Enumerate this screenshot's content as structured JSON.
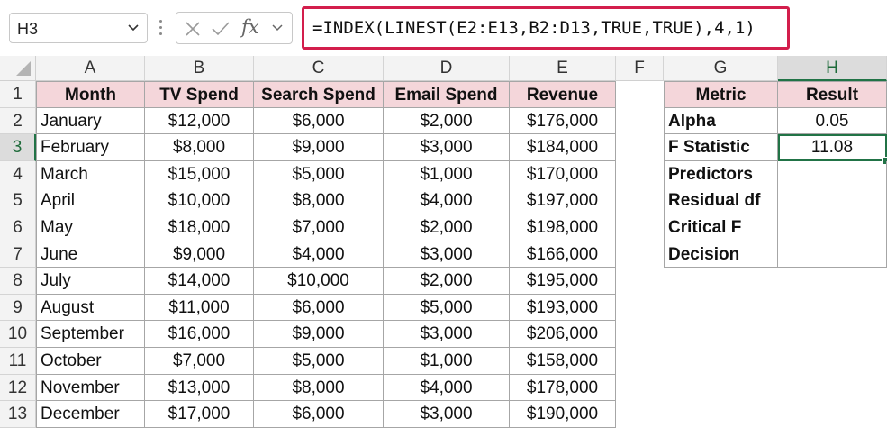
{
  "formula_bar": {
    "name_box": "H3",
    "formula": "=INDEX(LINEST(E2:E13,B2:D13,TRUE,TRUE),4,1)",
    "cancel_icon": "x-icon",
    "enter_icon": "check-icon",
    "fx_label": "fx"
  },
  "columns": [
    "A",
    "B",
    "C",
    "D",
    "E",
    "F",
    "G",
    "H"
  ],
  "rows": [
    "1",
    "2",
    "3",
    "4",
    "5",
    "6",
    "7",
    "8",
    "9",
    "10",
    "11",
    "12",
    "13"
  ],
  "table": {
    "headers": [
      "Month",
      "TV Spend",
      "Search Spend",
      "Email Spend",
      "Revenue"
    ],
    "rows": [
      [
        "January",
        "$12,000",
        "$6,000",
        "$2,000",
        "$176,000"
      ],
      [
        "February",
        "$8,000",
        "$9,000",
        "$3,000",
        "$184,000"
      ],
      [
        "March",
        "$15,000",
        "$5,000",
        "$1,000",
        "$170,000"
      ],
      [
        "April",
        "$10,000",
        "$8,000",
        "$4,000",
        "$197,000"
      ],
      [
        "May",
        "$18,000",
        "$7,000",
        "$2,000",
        "$198,000"
      ],
      [
        "June",
        "$9,000",
        "$4,000",
        "$3,000",
        "$166,000"
      ],
      [
        "July",
        "$14,000",
        "$10,000",
        "$2,000",
        "$195,000"
      ],
      [
        "August",
        "$11,000",
        "$6,000",
        "$5,000",
        "$193,000"
      ],
      [
        "September",
        "$16,000",
        "$9,000",
        "$3,000",
        "$206,000"
      ],
      [
        "October",
        "$7,000",
        "$5,000",
        "$1,000",
        "$158,000"
      ],
      [
        "November",
        "$13,000",
        "$8,000",
        "$4,000",
        "$178,000"
      ],
      [
        "December",
        "$17,000",
        "$6,000",
        "$3,000",
        "$190,000"
      ]
    ]
  },
  "metrics": {
    "headers": [
      "Metric",
      "Result"
    ],
    "rows": [
      [
        "Alpha",
        "0.05"
      ],
      [
        "F Statistic",
        "11.08"
      ],
      [
        "Predictors",
        ""
      ],
      [
        "Residual df",
        ""
      ],
      [
        "Critical F",
        ""
      ],
      [
        "Decision",
        ""
      ]
    ]
  },
  "selection": {
    "active_cell": "H3",
    "active_column": "H",
    "active_row": "3"
  },
  "colors": {
    "accent": "#217346",
    "header_fill": "#f4d6da",
    "formula_highlight": "#d31e4c"
  }
}
